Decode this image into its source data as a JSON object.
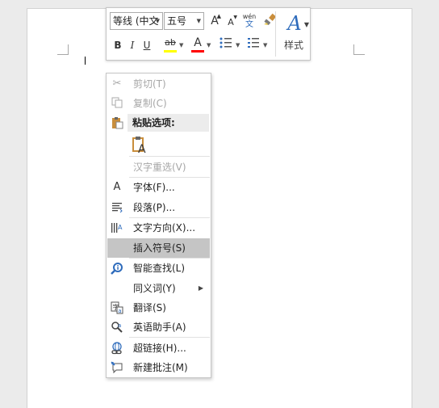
{
  "mini_toolbar": {
    "font_name": "等线 (中文",
    "font_size": "五号",
    "grow_font_icon": "A",
    "shrink_font_icon": "A",
    "phonetic_top": "wén",
    "phonetic_bottom": "文",
    "bold": "B",
    "italic": "I",
    "underline": "U",
    "highlight": "ab",
    "font_color": "A",
    "styles_label": "样式",
    "highlight_color": "#ffff00",
    "font_color_value": "#ff0000"
  },
  "context_menu": {
    "cut": "剪切(T)",
    "copy": "复制(C)",
    "paste_header": "粘贴选项:",
    "reconvert": "汉字重选(V)",
    "font": "字体(F)...",
    "paragraph": "段落(P)...",
    "text_direction": "文字方向(X)...",
    "insert_symbol": "插入符号(S)",
    "smart_lookup": "智能查找(L)",
    "synonyms": "同义词(Y)",
    "translate": "翻译(S)",
    "english_assistant": "英语助手(A)",
    "hyperlink": "超链接(H)...",
    "new_comment": "新建批注(M)"
  }
}
